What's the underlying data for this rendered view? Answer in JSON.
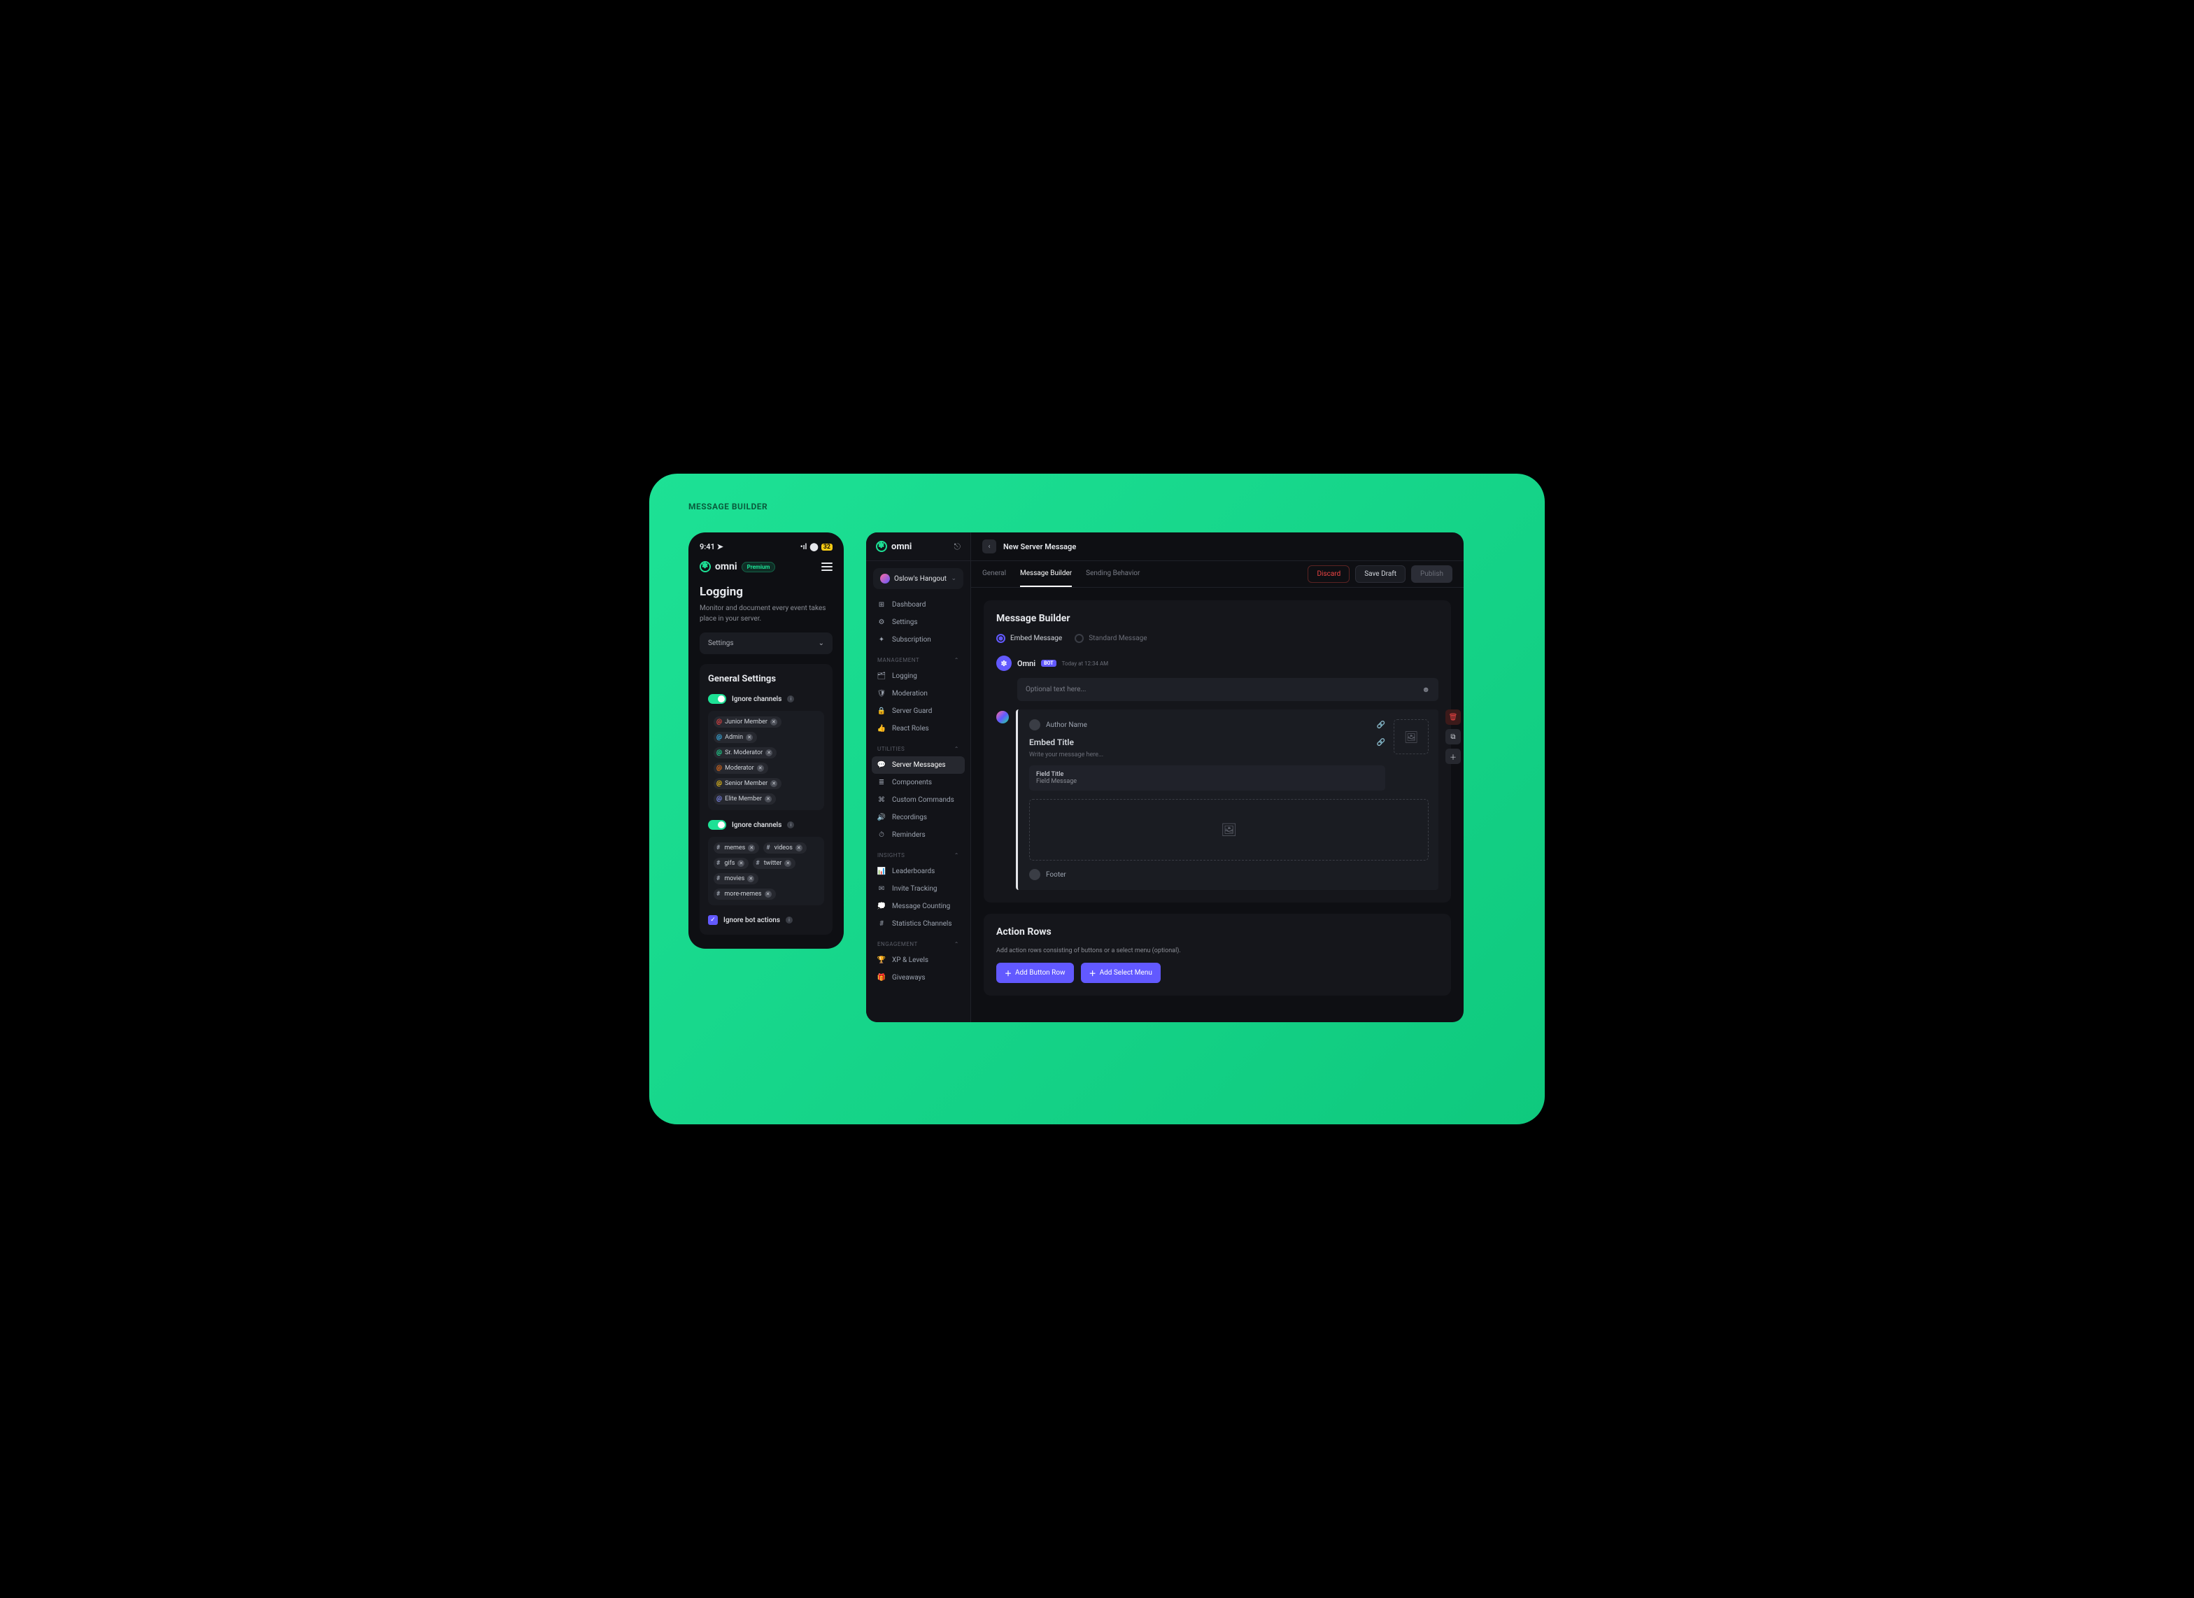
{
  "page_label": "MESSAGE BUILDER",
  "mobile": {
    "status_time": "9:41",
    "battery": "32",
    "brand": "omni",
    "premium_label": "Premium",
    "title": "Logging",
    "subtitle": "Monitor and document every event takes place in your server.",
    "settings_select": "Settings",
    "card_title": "General Settings",
    "toggle1_label": "Ignore channels",
    "roles": [
      {
        "name": "Junior Member",
        "color": "#ef4444"
      },
      {
        "name": "Admin",
        "color": "#38bdf8"
      },
      {
        "name": "Sr. Moderator",
        "color": "#1de195"
      },
      {
        "name": "Moderator",
        "color": "#f97316"
      },
      {
        "name": "Senior Member",
        "color": "#facc15"
      },
      {
        "name": "Elite Member",
        "color": "#818cf8"
      }
    ],
    "toggle2_label": "Ignore channels",
    "channels": [
      "memes",
      "videos",
      "gifs",
      "twitter",
      "movies",
      "more-memes"
    ],
    "checkbox_label": "Ignore bot actions"
  },
  "desktop": {
    "brand": "omni",
    "server_name": "Oslow's Hangout",
    "nav_top": [
      {
        "icon": "⊞",
        "label": "Dashboard"
      },
      {
        "icon": "⚙",
        "label": "Settings"
      },
      {
        "icon": "✦",
        "label": "Subscription"
      }
    ],
    "groups": [
      {
        "title": "MANAGEMENT",
        "items": [
          {
            "icon": "🗂",
            "label": "Logging"
          },
          {
            "icon": "🛡",
            "label": "Moderation"
          },
          {
            "icon": "🔒",
            "label": "Server Guard"
          },
          {
            "icon": "👍",
            "label": "React Roles"
          }
        ]
      },
      {
        "title": "UTILITIES",
        "items": [
          {
            "icon": "💬",
            "label": "Server Messages",
            "active": true
          },
          {
            "icon": "≣",
            "label": "Components"
          },
          {
            "icon": "⌘",
            "label": "Custom Commands"
          },
          {
            "icon": "🔊",
            "label": "Recordings"
          },
          {
            "icon": "⏱",
            "label": "Reminders"
          }
        ]
      },
      {
        "title": "INSIGHTS",
        "items": [
          {
            "icon": "📊",
            "label": "Leaderboards"
          },
          {
            "icon": "✉",
            "label": "Invite Tracking"
          },
          {
            "icon": "💭",
            "label": "Message Counting"
          },
          {
            "icon": "#",
            "label": "Statistics Channels"
          }
        ]
      },
      {
        "title": "ENGAGEMENT",
        "items": [
          {
            "icon": "🏆",
            "label": "XP & Levels"
          },
          {
            "icon": "🎁",
            "label": "Giveaways"
          }
        ]
      }
    ],
    "top_title": "New Server Message",
    "tabs": [
      "General",
      "Message Builder",
      "Sending Behavior"
    ],
    "active_tab": "Message Builder",
    "btn_discard": "Discard",
    "btn_save": "Save Draft",
    "btn_publish": "Publish",
    "panel_title": "Message Builder",
    "radio_embed": "Embed Message",
    "radio_standard": "Standard Message",
    "bot_name": "Omni",
    "bot_badge": "BOT",
    "bot_time": "Today at 12:34 AM",
    "optional_placeholder": "Optional text here...",
    "author_placeholder": "Author Name",
    "embed_title_placeholder": "Embed Title",
    "embed_desc_placeholder": "Write your message here...",
    "field_title": "Field Title",
    "field_msg": "Field Message",
    "footer_placeholder": "Footer",
    "action_title": "Action Rows",
    "action_desc": "Add action rows consisting of buttons or a select menu (optional).",
    "btn_add_row": "Add Button Row",
    "btn_add_menu": "Add Select Menu"
  }
}
